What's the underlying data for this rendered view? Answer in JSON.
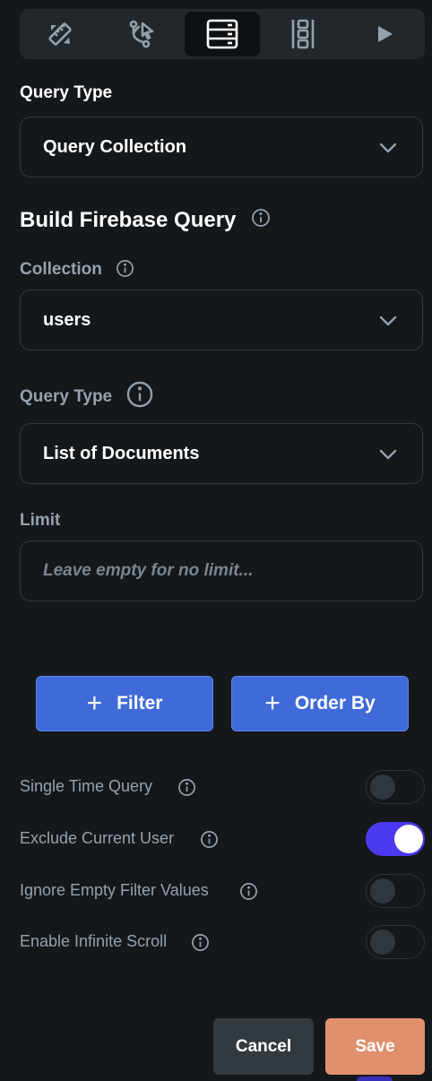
{
  "tabs": [
    {
      "icon": "design-tools-icon",
      "active": false
    },
    {
      "icon": "action-flow-icon",
      "active": false
    },
    {
      "icon": "backend-query-icon",
      "active": true
    },
    {
      "icon": "layout-columns-icon",
      "active": false
    },
    {
      "icon": "play-icon",
      "active": false
    }
  ],
  "query_type_section": {
    "label": "Query Type",
    "selected": "Query Collection"
  },
  "build_query": {
    "heading": "Build Firebase Query",
    "collection_label": "Collection",
    "collection_value": "users",
    "query_type_label": "Query Type",
    "query_type_value": "List of Documents",
    "limit_label": "Limit",
    "limit_value": "",
    "limit_placeholder": "Leave empty for no limit..."
  },
  "actions": {
    "filter_label": "Filter",
    "order_by_label": "Order By",
    "plus_glyph": "+"
  },
  "options": [
    {
      "label": "Single Time Query",
      "enabled": false
    },
    {
      "label": "Exclude Current User",
      "enabled": true
    },
    {
      "label": "Ignore Empty Filter Values",
      "enabled": false
    },
    {
      "label": "Enable Infinite Scroll",
      "enabled": false
    }
  ],
  "footer": {
    "cancel_label": "Cancel",
    "save_label": "Save"
  },
  "colors": {
    "background": "#14181b",
    "accent_blue": "#3f6ad8",
    "toggle_on": "#4b39ef",
    "save": "#e0906d",
    "muted_text": "#95a1ac"
  }
}
